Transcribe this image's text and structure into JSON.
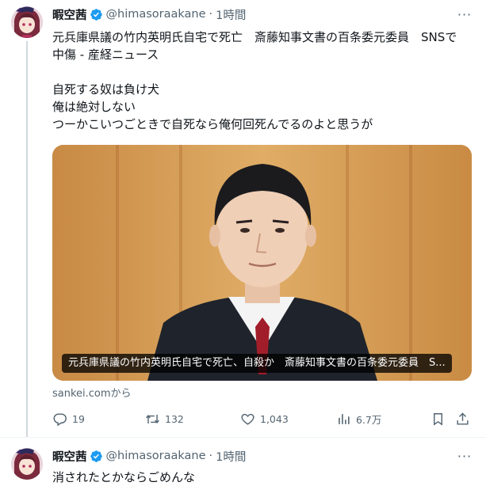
{
  "tweet1": {
    "name": "暇空茜",
    "handle": "@himasoraakane",
    "separator": "·",
    "time": "1時間",
    "more": "···",
    "lines": [
      "元兵庫県議の竹内英明氏自宅で死亡　斎藤知事文書の百条委元委員　SNSで",
      "中傷 - 産経ニュース",
      "",
      "自死する奴は負け犬",
      "俺は絶対しない",
      "つーかこいつごときで自死なら俺何回死んでるのよと思うが"
    ],
    "card": {
      "caption": "元兵庫県議の竹内英明氏自宅で死亡、自殺か　斎藤知事文書の百条委元委員　S...",
      "source": "sankei.comから"
    },
    "actions": {
      "reply_count": "19",
      "retweet_count": "132",
      "like_count": "1,043",
      "views_count": "6.7万"
    }
  },
  "tweet2": {
    "name": "暇空茜",
    "handle": "@himasoraakane",
    "separator": "·",
    "time": "1時間",
    "more": "···",
    "text": "消されたとかならごめんな"
  },
  "colors": {
    "verified": "#1d9bf0",
    "secondary_text": "#536471",
    "thread_line": "#cfd9de"
  },
  "icons": {
    "reply": "reply-icon",
    "retweet": "retweet-icon",
    "like": "heart-icon",
    "views": "views-icon",
    "bookmark": "bookmark-icon",
    "share": "share-icon"
  }
}
